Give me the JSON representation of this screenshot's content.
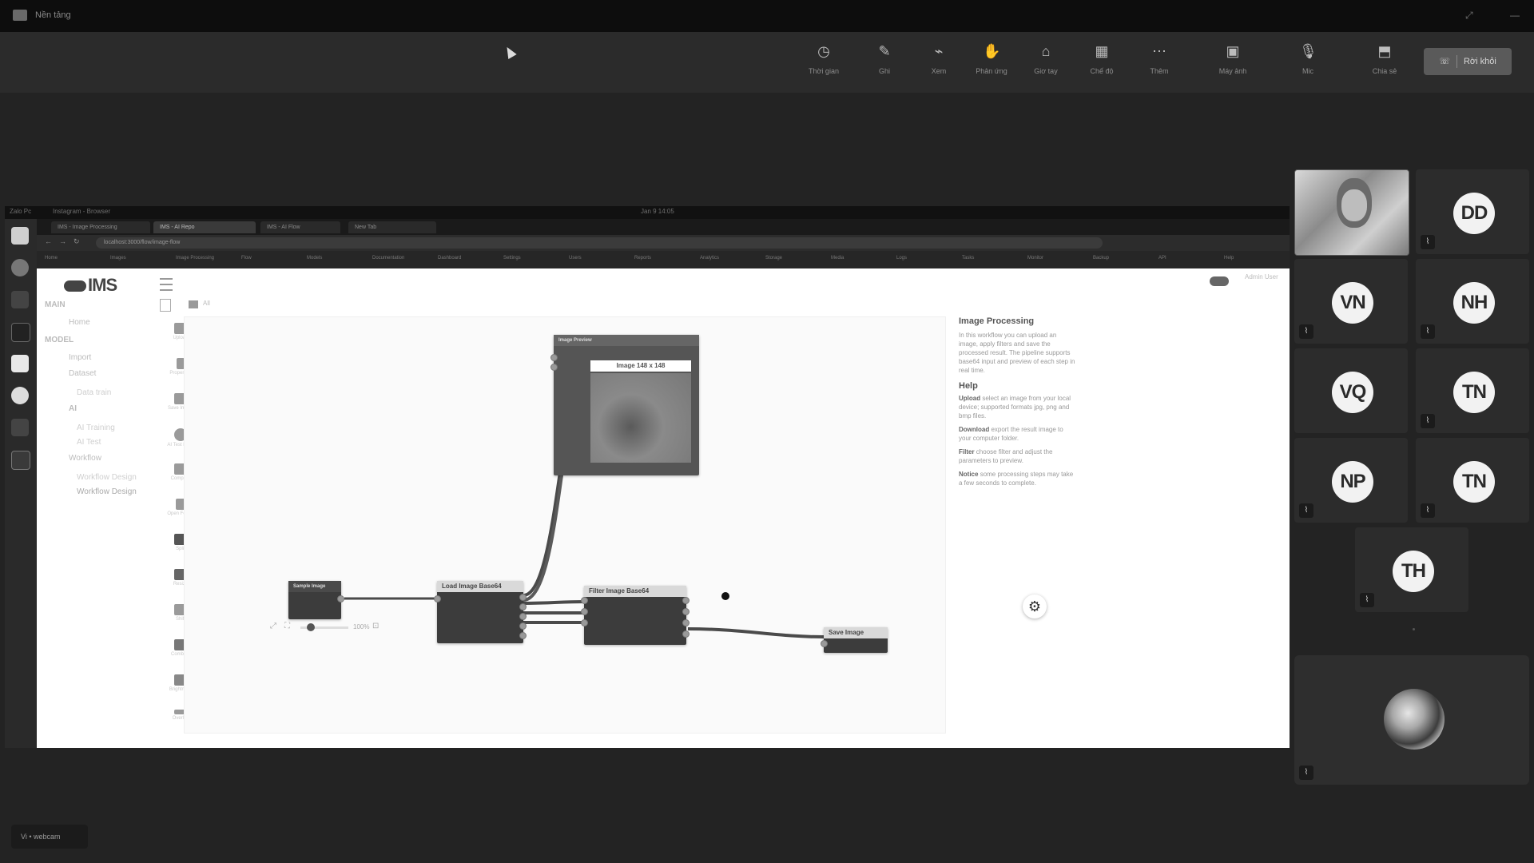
{
  "window": {
    "title": "Nền tảng",
    "controls": [
      "⤢",
      "—"
    ]
  },
  "toolbar": {
    "items": [
      {
        "icon": "clock-icon",
        "glyph": "◷",
        "label": "Thời gian"
      },
      {
        "icon": "pen-icon",
        "glyph": "✎",
        "label": "Ghi"
      },
      {
        "icon": "view-icon",
        "glyph": "⌁",
        "label": "Xem"
      },
      {
        "icon": "hand-icon",
        "glyph": "✋",
        "label": "Phản ứng"
      },
      {
        "icon": "raise-hand-icon",
        "glyph": "⌂",
        "label": "Giơ tay"
      },
      {
        "icon": "grid-icon",
        "glyph": "▦",
        "label": "Chế độ"
      },
      {
        "icon": "more-icon",
        "glyph": "⋯",
        "label": "Thêm"
      },
      {
        "icon": "camera-icon",
        "glyph": "▣",
        "label": "Máy ảnh"
      },
      {
        "icon": "mic-icon",
        "glyph": "🎙",
        "label": "Mic"
      },
      {
        "icon": "share-icon",
        "glyph": "⬒",
        "label": "Chia sẻ"
      }
    ],
    "leave_label": "Rời khỏi",
    "phone_glyph": "☏"
  },
  "shared": {
    "os_bar": [
      "Zalo Pc",
      "Instagram - Browser"
    ],
    "os_bar_right": "Jan 9  14:05",
    "tabs": [
      "IMS - Image Processing",
      "IMS - AI Repo",
      "IMS - AI Flow",
      "New Tab"
    ],
    "url": "localhost:3000/flow/image-flow",
    "bookmarks": [
      "Home",
      "Images",
      "Image Processing",
      "Flow",
      "Models",
      "Documentation",
      "Dashboard",
      "Settings",
      "Users",
      "Reports",
      "Analytics",
      "Storage",
      "Media",
      "Logs",
      "Tasks",
      "Monitor",
      "Backup",
      "API",
      "Help"
    ]
  },
  "app": {
    "logo_text": "IMS",
    "user_label": "Admin User",
    "menu": {
      "main_title": "MAIN",
      "main_items": [
        "Home"
      ],
      "model_title": "MODEL",
      "model_items": [
        "Import",
        "Dataset"
      ],
      "dataset_sub": [
        "Data train"
      ],
      "ai_title": "AI",
      "ai_items": [
        "AI Training",
        "AI Test"
      ],
      "workflow_title": "Workflow",
      "workflow_items": [
        "Workflow Design",
        "Workflow Design"
      ]
    },
    "node_icons": [
      "Upload",
      "Properties",
      "Save Image",
      "AI Test Face",
      "Compare",
      "Open Folder",
      "Split",
      "Resize",
      "Shift",
      "Combine",
      "Brightness",
      "Overlay"
    ],
    "breadcrumb": "All",
    "nodes": {
      "source": "Sample Image",
      "load": "Load Image Base64",
      "preview": "Image Preview",
      "preview_caption": "Image 148 x 148",
      "process": "Filter Image Base64",
      "output": "Save Image"
    },
    "right_panel": {
      "title": "Image Processing",
      "intro": "In this workflow you can upload an image, apply filters and save the processed result. The pipeline supports base64 input and preview of each step in real time.",
      "help_title": "Help",
      "help_items": [
        {
          "k": "Upload",
          "v": "select an image from your local device; supported formats jpg, png and bmp files."
        },
        {
          "k": "Download",
          "v": "export the result image to your computer folder."
        },
        {
          "k": "Filter",
          "v": "choose filter and adjust the parameters to preview."
        },
        {
          "k": "Notice",
          "v": "some processing steps may take a few seconds to complete."
        }
      ]
    },
    "zoom": "100%"
  },
  "participants": [
    {
      "initials": "DD"
    },
    {
      "initials": "VN"
    },
    {
      "initials": "NH"
    },
    {
      "initials": "VQ"
    },
    {
      "initials": "TN"
    },
    {
      "initials": "NP"
    },
    {
      "initials": "TN"
    },
    {
      "initials": "TH"
    }
  ],
  "status_pill": "Vi  •  webcam"
}
